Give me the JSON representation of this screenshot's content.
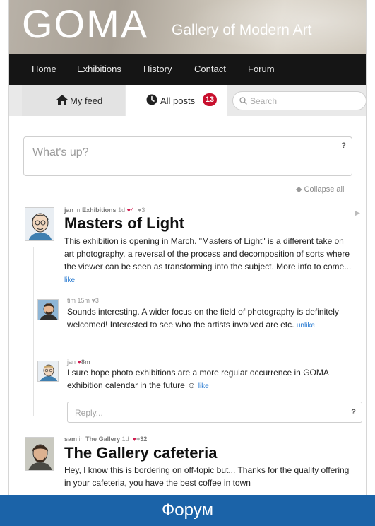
{
  "header": {
    "logo": "GOMA",
    "tagline": "Gallery of Modern Art"
  },
  "nav": {
    "items": [
      "Home",
      "Exhibitions",
      "History",
      "Contact",
      "Forum"
    ]
  },
  "tabs": {
    "feed_label": "My feed",
    "all_label": "All posts",
    "all_count": "13",
    "search_placeholder": "Search"
  },
  "compose": {
    "placeholder": "What's up?",
    "help": "?",
    "collapse_label": "Collapse all"
  },
  "posts": [
    {
      "author": "jan",
      "in_word": "in",
      "category": "Exhibitions",
      "age": "1d",
      "hearts": "4",
      "likes": "3",
      "title": "Masters of Light",
      "body": "This exhibition is opening in March. \"Masters of Light\" is a different take on art photography, a reversal of the process and decomposition of sorts where the viewer can be seen as transforming into the subject. More info to come...",
      "action": "like",
      "comments": [
        {
          "author": "tim",
          "age": "15m",
          "likes": "3",
          "body": "Sounds interesting. A wider focus on the field of photography is definitely welcomed! Interested to see who the artists involved are etc.",
          "action": "unlike"
        },
        {
          "author": "jan",
          "age": "8m",
          "body": "I sure hope photo exhibitions are a more regular occurrence in GOMA exhibition calendar in the future",
          "emoji": "☺",
          "action": "like"
        }
      ],
      "reply_placeholder": "Reply...",
      "reply_help": "?"
    },
    {
      "author": "sam",
      "in_word": "in",
      "category": "The Gallery",
      "age": "1d",
      "hearts": "+32",
      "title": "The Gallery cafeteria",
      "body": "Hey, I know this is bordering on off-topic but... Thanks for the quality offering in your cafeteria, you have the best coffee in town"
    }
  ],
  "footer": {
    "caption": "Форум"
  }
}
